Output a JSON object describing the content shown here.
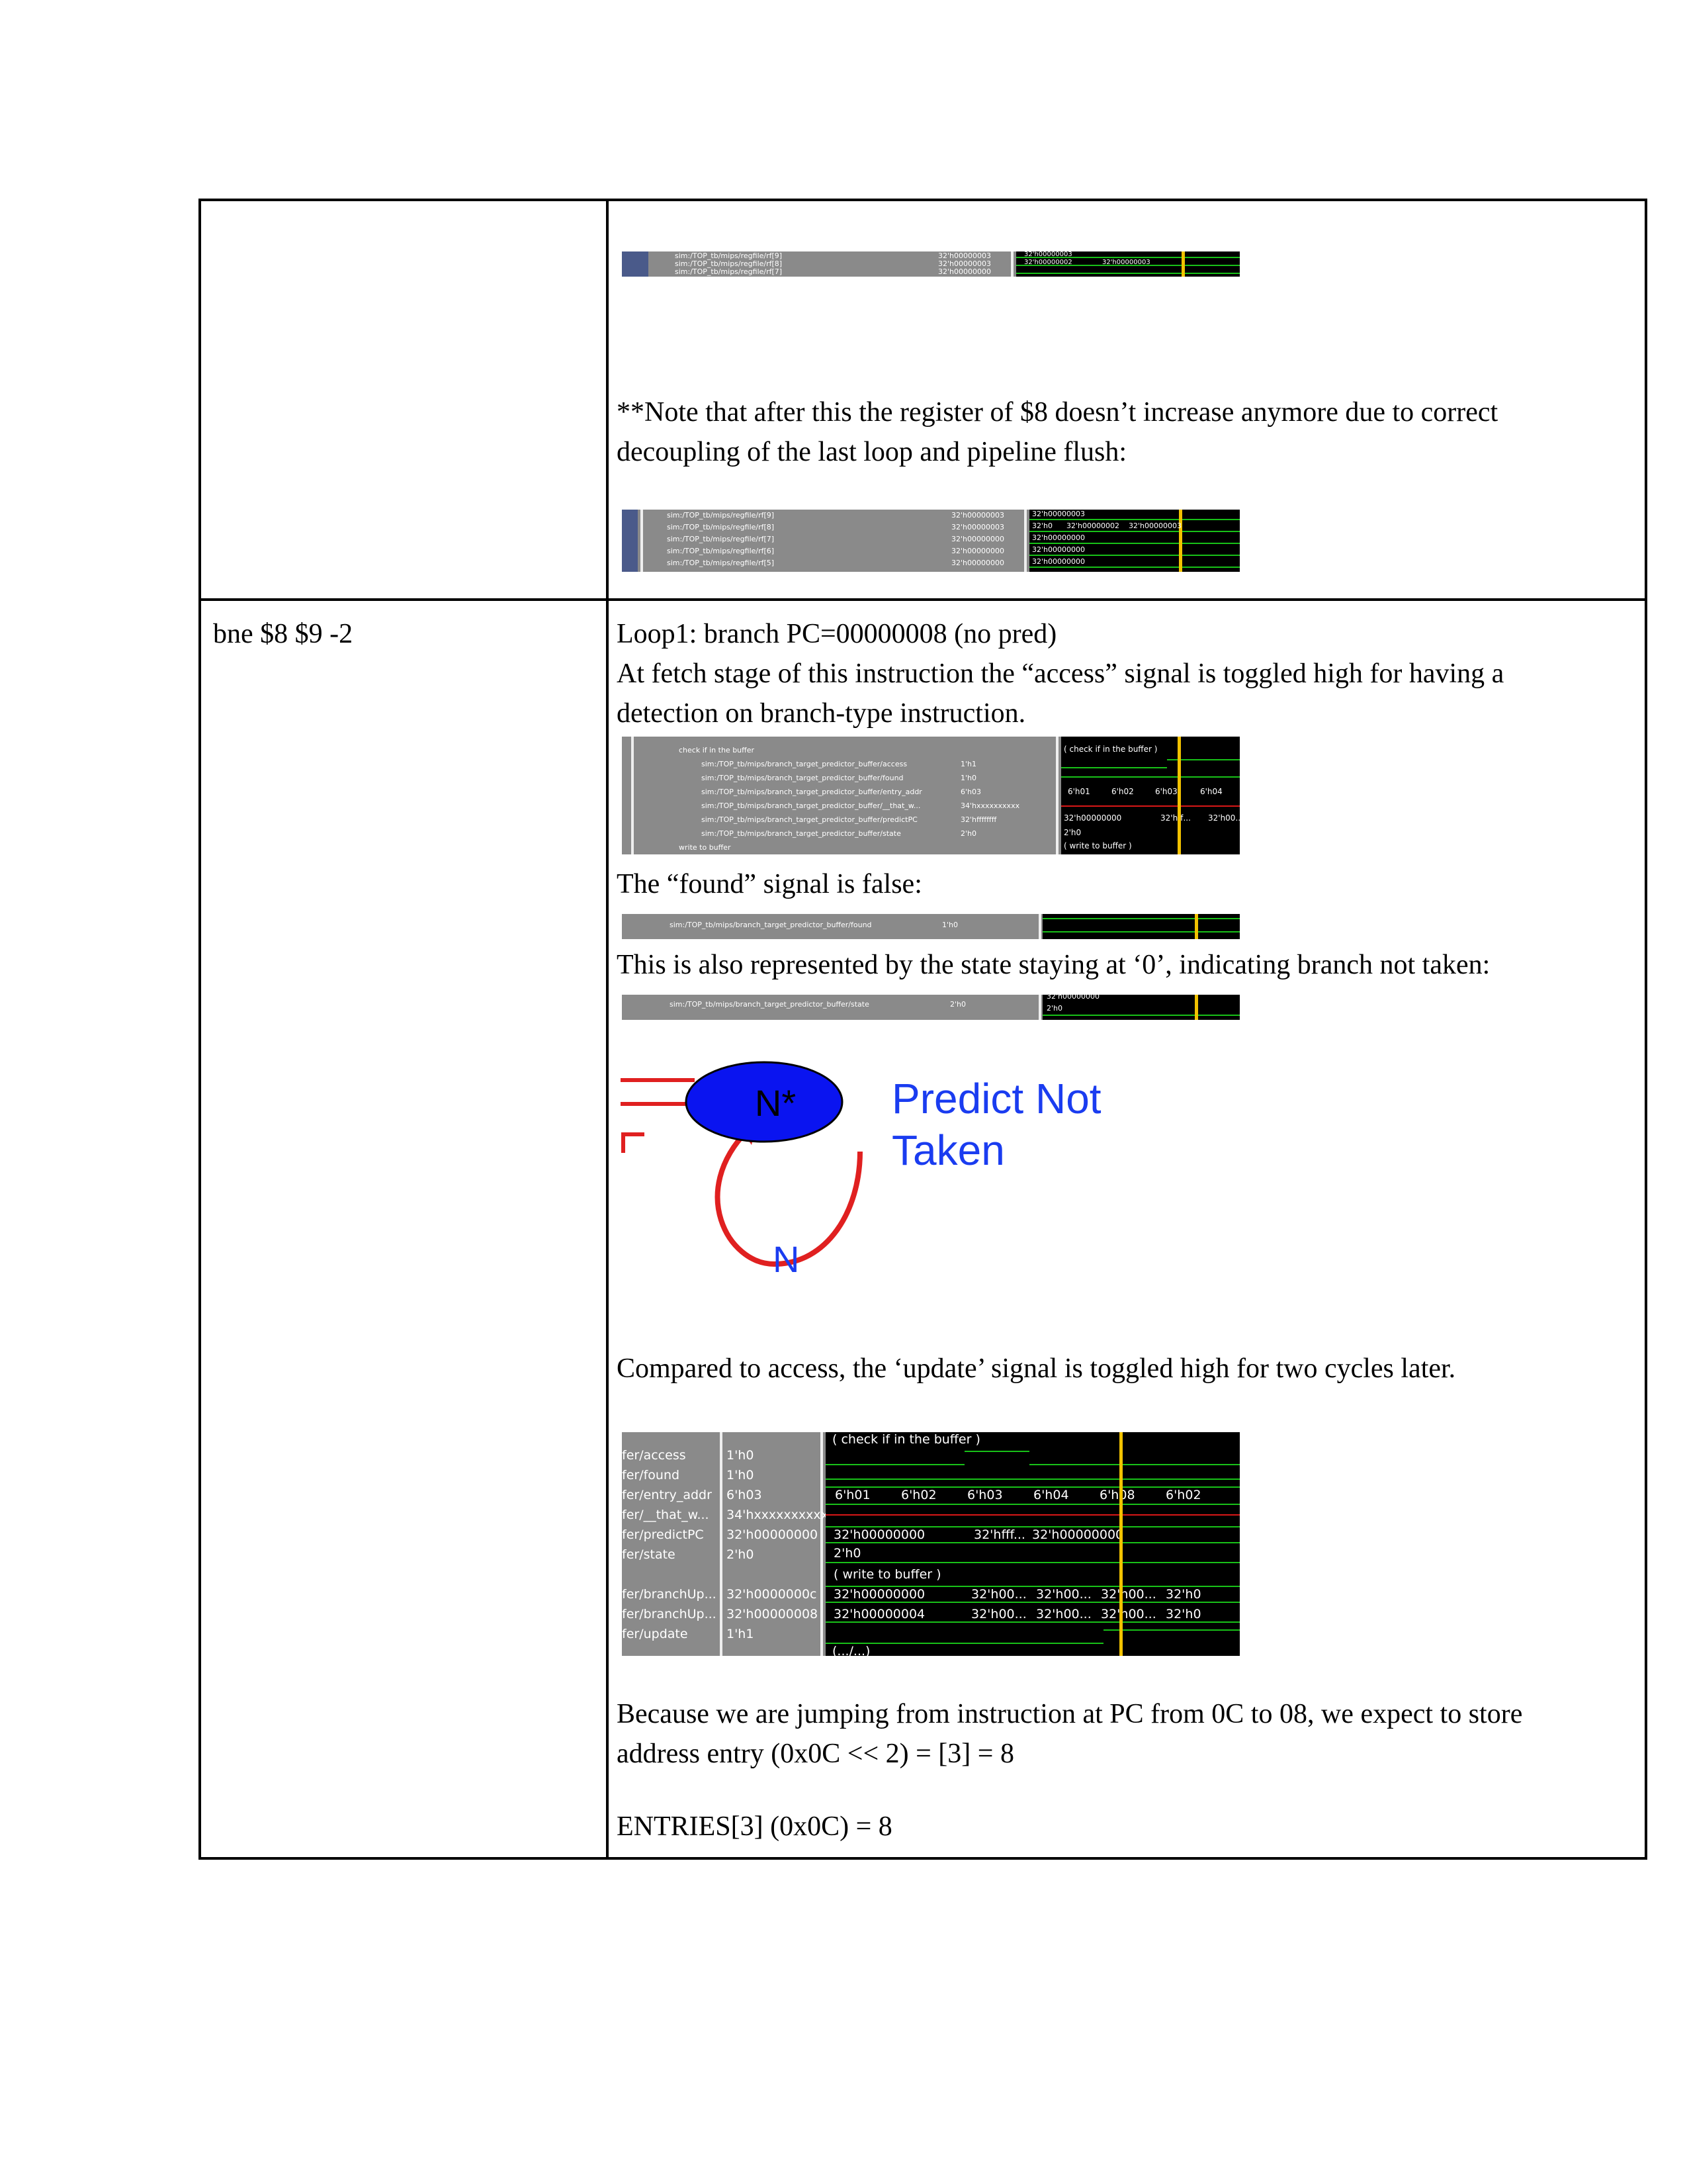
{
  "top_row": {
    "waveform_1": {
      "signals": [
        "sim:/TOP_tb/mips/regfile/rf[9]",
        "sim:/TOP_tb/mips/regfile/rf[8]",
        "sim:/TOP_tb/mips/regfile/rf[7]"
      ],
      "values": [
        "32'h00000003",
        "32'h00000003",
        "32'h00000000"
      ],
      "wave_labels": [
        "32'h00000003",
        "32'h00000002",
        "32'h00000003"
      ]
    },
    "note_line1": "**Note that after this the register of $8 doesn’t increase anymore due to correct",
    "note_line2": "decoupling of the last loop and pipeline flush:",
    "waveform_2": {
      "signals": [
        "sim:/TOP_tb/mips/regfile/rf[9]",
        "sim:/TOP_tb/mips/regfile/rf[8]",
        "sim:/TOP_tb/mips/regfile/rf[7]",
        "sim:/TOP_tb/mips/regfile/rf[6]",
        "sim:/TOP_tb/mips/regfile/rf[5]"
      ],
      "values": [
        "32'h00000003",
        "32'h00000003",
        "32'h00000000",
        "32'h00000000",
        "32'h00000000"
      ],
      "wave_labels": [
        "32'h00000003",
        "32'h0",
        "32'h00000002",
        "32'h00000003",
        "32'h00000000",
        "32'h00000000",
        "32'h00000000"
      ]
    }
  },
  "bottom_row": {
    "instruction": "bne $8 $9 -2",
    "line1": "Loop1: branch PC=00000008 (no pred)",
    "line2": "At fetch stage of this instruction the “access” signal is toggled high for having a",
    "line3": "detection on branch-type instruction.",
    "waveform_3": {
      "groups": [
        "check if in the buffer",
        "write to buffer"
      ],
      "signals": [
        "sim:/TOP_tb/mips/branch_target_predictor_buffer/access",
        "sim:/TOP_tb/mips/branch_target_predictor_buffer/found",
        "sim:/TOP_tb/mips/branch_target_predictor_buffer/entry_addr",
        "sim:/TOP_tb/mips/branch_target_predictor_buffer/__that_w...",
        "sim:/TOP_tb/mips/branch_target_predictor_buffer/predictPC",
        "sim:/TOP_tb/mips/branch_target_predictor_buffer/state"
      ],
      "values": [
        "1'h1",
        "1'h0",
        "6'h03",
        "34'hxxxxxxxxxx",
        "32'hffffffff",
        "2'h0"
      ],
      "wave_labels": [
        "( check if in the buffer )",
        "6'h01",
        "6'h02",
        "6'h03",
        "6'h04",
        "32'h00000000",
        "32'hff...",
        "32'h00...",
        "2'h0",
        "( write to buffer )"
      ]
    },
    "found_text": "The “found” signal is false:",
    "waveform_4": {
      "signals": [
        "sim:/TOP_tb/mips/branch_target_predictor_buffer/found"
      ],
      "values": [
        "1'h0"
      ]
    },
    "state_text": "This is also represented by the state staying at ‘0’, indicating branch not taken:",
    "waveform_5": {
      "signals": [
        "sim:/TOP_tb/mips/branch_target_predictor_buffer/state"
      ],
      "values": [
        "2'h0"
      ],
      "wave_labels": [
        "32'h00000000",
        "2'h0"
      ]
    },
    "fsm": {
      "state_label": "N*",
      "predict_line1": "Predict Not",
      "predict_line2": "Taken",
      "loop_label": "N",
      "colors": {
        "state_fill": "#0a14f0",
        "arrow": "#e02020",
        "text": "#1a3cf0"
      }
    },
    "update_text": "Compared to access, the ‘update’ signal is toggled high for two cycles later.",
    "waveform_6": {
      "signals": [
        "fer/access",
        "fer/found",
        "fer/entry_addr",
        "fer/__that_w...",
        "fer/predictPC",
        "fer/state",
        "fer/branchUp...",
        "fer/branchUp...",
        "fer/update"
      ],
      "values": [
        "1'h0",
        "1'h0",
        "6'h03",
        "34'hxxxxxxxxxx",
        "32'h00000000",
        "2'h0",
        "32'h0000000c",
        "32'h00000008",
        "1'h1"
      ],
      "group_check": "( check if in the buffer )",
      "group_write": "( write to buffer )",
      "entry_labels": [
        "6'h01",
        "6'h02",
        "6'h03",
        "6'h04",
        "6'h08",
        "6'h02"
      ],
      "pc_labels": [
        "32'h00000000",
        "32'hfff...",
        "32'h00000000"
      ],
      "state_label": "2'h0",
      "up1_labels": [
        "32'h00000000",
        "32'h00...",
        "32'h00...",
        "32'h00...",
        "32'h0"
      ],
      "up2_labels": [
        "32'h00000004",
        "32'h00...",
        "32'h00...",
        "32'h00...",
        "32'h0"
      ],
      "bottom_label": "(.../...)"
    },
    "because_line1": "Because we are jumping from instruction at PC from 0C to 08, we expect to store",
    "because_line2": "address entry (0x0C << 2) = [3] = 8",
    "entries_text": "ENTRIES[3] (0x0C) = 8"
  }
}
